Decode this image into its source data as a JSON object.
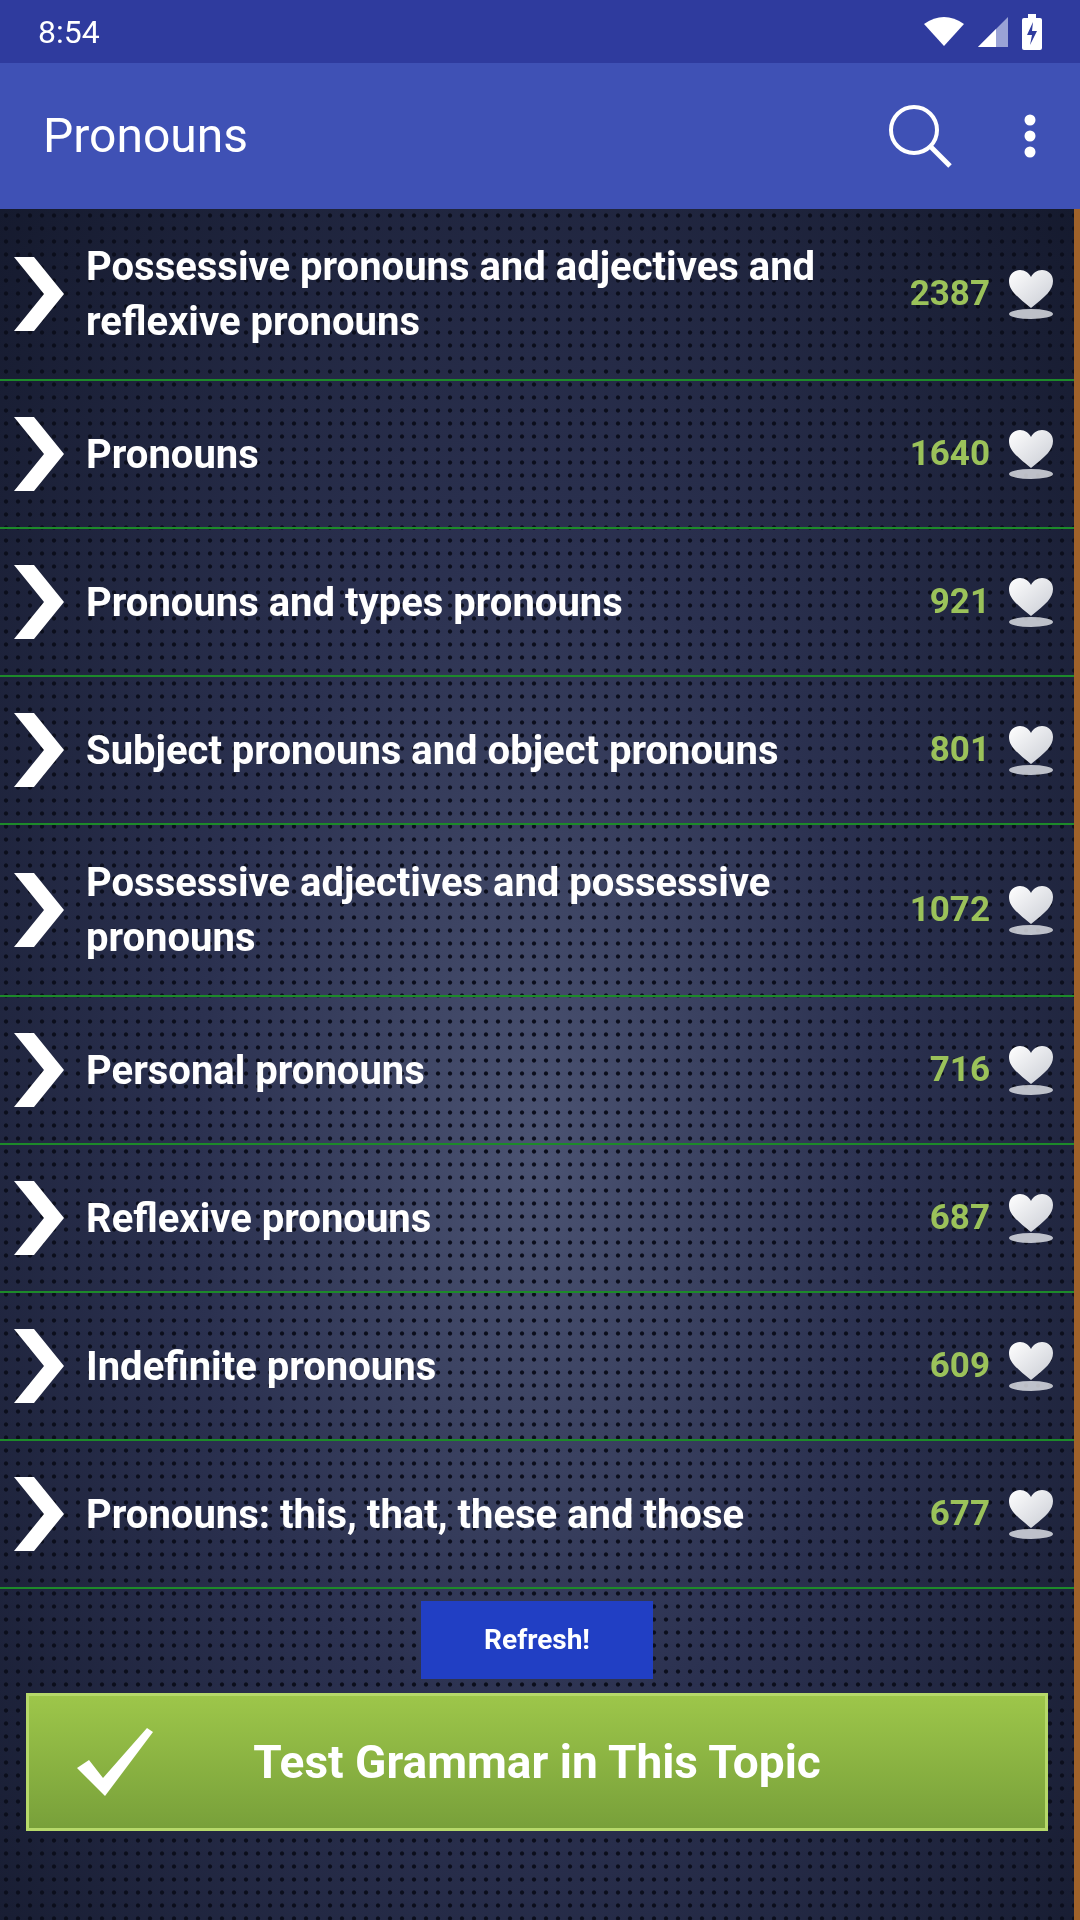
{
  "status_bar": {
    "time": "8:54"
  },
  "app_bar": {
    "title": "Pronouns"
  },
  "topics": [
    {
      "title": "Possessive pronouns and adjectives and reflexive pronouns",
      "count": "2387"
    },
    {
      "title": "Pronouns",
      "count": "1640"
    },
    {
      "title": "Pronouns and types pronouns",
      "count": "921"
    },
    {
      "title": "Subject pronouns and object pronouns",
      "count": "801"
    },
    {
      "title": "Possessive adjectives and possessive pronouns",
      "count": "1072"
    },
    {
      "title": "Personal pronouns",
      "count": "716"
    },
    {
      "title": "Reflexive pronouns",
      "count": "687"
    },
    {
      "title": "Indefinite pronouns",
      "count": "609"
    },
    {
      "title": "Pronouns: this, that, these and those",
      "count": "677"
    }
  ],
  "refresh_button": {
    "label": "Refresh!"
  },
  "test_button": {
    "label": "Test Grammar in This Topic"
  }
}
